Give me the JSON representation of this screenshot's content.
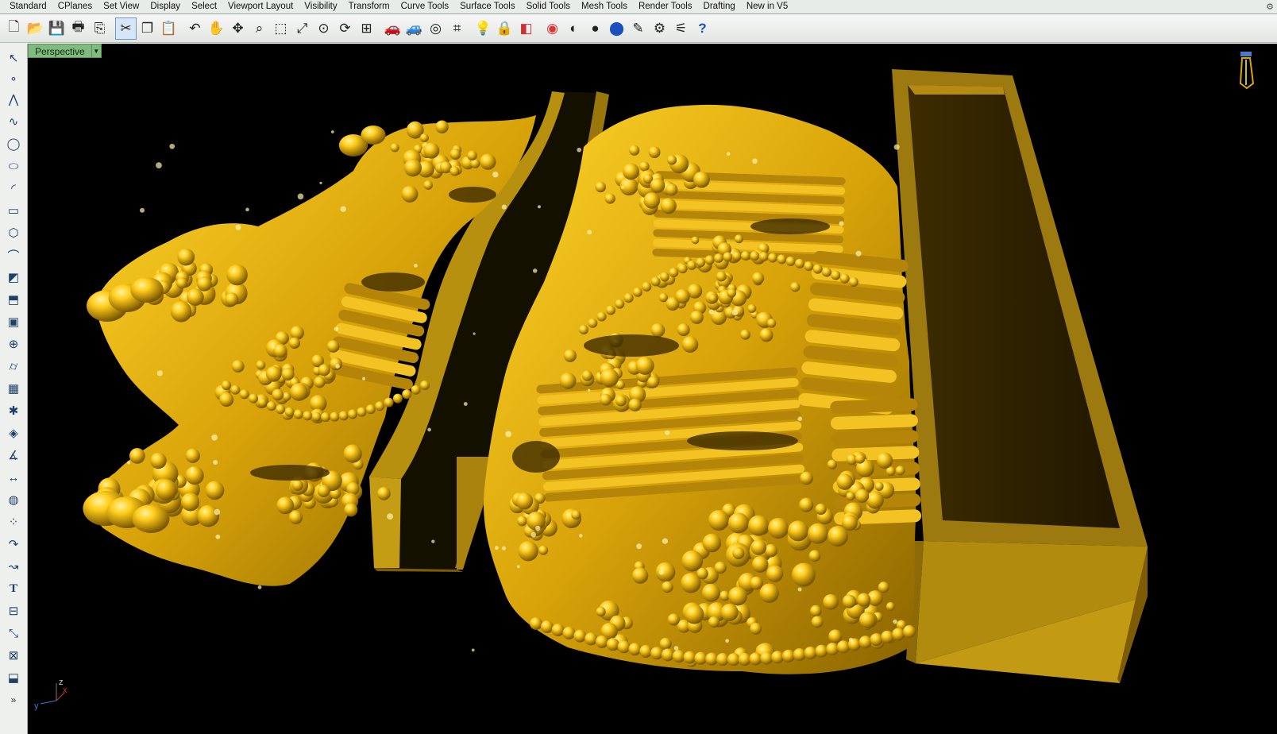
{
  "menu_tabs": [
    {
      "label": "Standard",
      "active": true
    },
    {
      "label": "CPlanes"
    },
    {
      "label": "Set View"
    },
    {
      "label": "Display"
    },
    {
      "label": "Select"
    },
    {
      "label": "Viewport Layout"
    },
    {
      "label": "Visibility"
    },
    {
      "label": "Transform"
    },
    {
      "label": "Curve Tools"
    },
    {
      "label": "Surface Tools"
    },
    {
      "label": "Solid Tools"
    },
    {
      "label": "Mesh Tools"
    },
    {
      "label": "Render Tools"
    },
    {
      "label": "Drafting"
    },
    {
      "label": "New in V5"
    }
  ],
  "toolbar_icons": [
    "new-file-icon",
    "open-file-icon",
    "save-icon",
    "print-icon",
    "import-icon",
    "cut-icon",
    "copy-icon",
    "paste-icon",
    "undo-icon",
    "pan-hand-icon",
    "move-view-icon",
    "zoom-icon",
    "zoom-window-icon",
    "zoom-extents-icon",
    "zoom-selected-icon",
    "rotate-view-icon",
    "four-viewports-icon",
    "car-icon",
    "car-gray-icon",
    "cplane-icon",
    "snap-grid-icon",
    "light-icon",
    "lock-icon",
    "layer-icon",
    "color-wheel-icon",
    "render-preview-icon",
    "render-sphere-icon",
    "render-blue-sphere-icon",
    "pen-icon",
    "options-gear-icon",
    "properties-icon",
    "help-icon"
  ],
  "side_tools": [
    "select-arrow-icon",
    "point-icon",
    "polyline-icon",
    "curve-cp-icon",
    "circle-icon",
    "ellipse-icon",
    "arc-icon",
    "rectangle-icon",
    "polygon-icon",
    "fillet-icon",
    "surface-corner-icon",
    "extrude-icon",
    "box-icon",
    "boolean-icon",
    "cylinder-icon",
    "mesh-icon",
    "gear-transform-icon",
    "solid-tools-icon",
    "analyze-icon",
    "dimension-icon",
    "render-tools-icon",
    "group-icon",
    "curve-from-object-icon",
    "curve-offset-icon",
    "text-icon",
    "array-icon",
    "transform-icon",
    "block-icon",
    "box-edit-icon",
    "more-icon"
  ],
  "viewport": {
    "name": "Perspective",
    "axis_z": "z",
    "axis_y": "y",
    "axis_x": "x",
    "background": "#000000",
    "material_color": "#d4a00a",
    "material_shadow": "#6b4f00"
  }
}
